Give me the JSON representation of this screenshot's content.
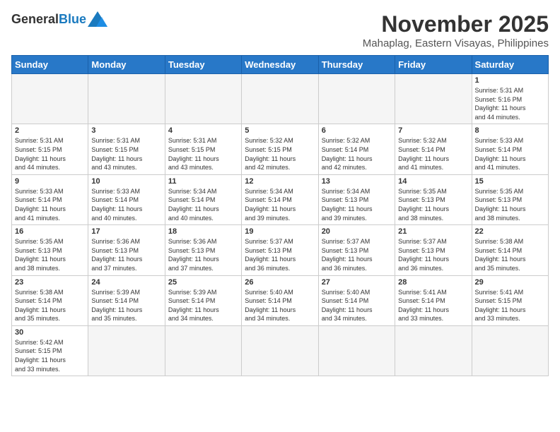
{
  "logo": {
    "general": "General",
    "blue": "Blue"
  },
  "header": {
    "month": "November 2025",
    "location": "Mahaplag, Eastern Visayas, Philippines"
  },
  "weekdays": [
    "Sunday",
    "Monday",
    "Tuesday",
    "Wednesday",
    "Thursday",
    "Friday",
    "Saturday"
  ],
  "weeks": [
    [
      {
        "day": "",
        "info": ""
      },
      {
        "day": "",
        "info": ""
      },
      {
        "day": "",
        "info": ""
      },
      {
        "day": "",
        "info": ""
      },
      {
        "day": "",
        "info": ""
      },
      {
        "day": "",
        "info": ""
      },
      {
        "day": "1",
        "info": "Sunrise: 5:31 AM\nSunset: 5:16 PM\nDaylight: 11 hours\nand 44 minutes."
      }
    ],
    [
      {
        "day": "2",
        "info": "Sunrise: 5:31 AM\nSunset: 5:15 PM\nDaylight: 11 hours\nand 44 minutes."
      },
      {
        "day": "3",
        "info": "Sunrise: 5:31 AM\nSunset: 5:15 PM\nDaylight: 11 hours\nand 43 minutes."
      },
      {
        "day": "4",
        "info": "Sunrise: 5:31 AM\nSunset: 5:15 PM\nDaylight: 11 hours\nand 43 minutes."
      },
      {
        "day": "5",
        "info": "Sunrise: 5:32 AM\nSunset: 5:15 PM\nDaylight: 11 hours\nand 42 minutes."
      },
      {
        "day": "6",
        "info": "Sunrise: 5:32 AM\nSunset: 5:14 PM\nDaylight: 11 hours\nand 42 minutes."
      },
      {
        "day": "7",
        "info": "Sunrise: 5:32 AM\nSunset: 5:14 PM\nDaylight: 11 hours\nand 41 minutes."
      },
      {
        "day": "8",
        "info": "Sunrise: 5:33 AM\nSunset: 5:14 PM\nDaylight: 11 hours\nand 41 minutes."
      }
    ],
    [
      {
        "day": "9",
        "info": "Sunrise: 5:33 AM\nSunset: 5:14 PM\nDaylight: 11 hours\nand 41 minutes."
      },
      {
        "day": "10",
        "info": "Sunrise: 5:33 AM\nSunset: 5:14 PM\nDaylight: 11 hours\nand 40 minutes."
      },
      {
        "day": "11",
        "info": "Sunrise: 5:34 AM\nSunset: 5:14 PM\nDaylight: 11 hours\nand 40 minutes."
      },
      {
        "day": "12",
        "info": "Sunrise: 5:34 AM\nSunset: 5:14 PM\nDaylight: 11 hours\nand 39 minutes."
      },
      {
        "day": "13",
        "info": "Sunrise: 5:34 AM\nSunset: 5:13 PM\nDaylight: 11 hours\nand 39 minutes."
      },
      {
        "day": "14",
        "info": "Sunrise: 5:35 AM\nSunset: 5:13 PM\nDaylight: 11 hours\nand 38 minutes."
      },
      {
        "day": "15",
        "info": "Sunrise: 5:35 AM\nSunset: 5:13 PM\nDaylight: 11 hours\nand 38 minutes."
      }
    ],
    [
      {
        "day": "16",
        "info": "Sunrise: 5:35 AM\nSunset: 5:13 PM\nDaylight: 11 hours\nand 38 minutes."
      },
      {
        "day": "17",
        "info": "Sunrise: 5:36 AM\nSunset: 5:13 PM\nDaylight: 11 hours\nand 37 minutes."
      },
      {
        "day": "18",
        "info": "Sunrise: 5:36 AM\nSunset: 5:13 PM\nDaylight: 11 hours\nand 37 minutes."
      },
      {
        "day": "19",
        "info": "Sunrise: 5:37 AM\nSunset: 5:13 PM\nDaylight: 11 hours\nand 36 minutes."
      },
      {
        "day": "20",
        "info": "Sunrise: 5:37 AM\nSunset: 5:13 PM\nDaylight: 11 hours\nand 36 minutes."
      },
      {
        "day": "21",
        "info": "Sunrise: 5:37 AM\nSunset: 5:13 PM\nDaylight: 11 hours\nand 36 minutes."
      },
      {
        "day": "22",
        "info": "Sunrise: 5:38 AM\nSunset: 5:14 PM\nDaylight: 11 hours\nand 35 minutes."
      }
    ],
    [
      {
        "day": "23",
        "info": "Sunrise: 5:38 AM\nSunset: 5:14 PM\nDaylight: 11 hours\nand 35 minutes."
      },
      {
        "day": "24",
        "info": "Sunrise: 5:39 AM\nSunset: 5:14 PM\nDaylight: 11 hours\nand 35 minutes."
      },
      {
        "day": "25",
        "info": "Sunrise: 5:39 AM\nSunset: 5:14 PM\nDaylight: 11 hours\nand 34 minutes."
      },
      {
        "day": "26",
        "info": "Sunrise: 5:40 AM\nSunset: 5:14 PM\nDaylight: 11 hours\nand 34 minutes."
      },
      {
        "day": "27",
        "info": "Sunrise: 5:40 AM\nSunset: 5:14 PM\nDaylight: 11 hours\nand 34 minutes."
      },
      {
        "day": "28",
        "info": "Sunrise: 5:41 AM\nSunset: 5:14 PM\nDaylight: 11 hours\nand 33 minutes."
      },
      {
        "day": "29",
        "info": "Sunrise: 5:41 AM\nSunset: 5:15 PM\nDaylight: 11 hours\nand 33 minutes."
      }
    ],
    [
      {
        "day": "30",
        "info": "Sunrise: 5:42 AM\nSunset: 5:15 PM\nDaylight: 11 hours\nand 33 minutes."
      },
      {
        "day": "",
        "info": ""
      },
      {
        "day": "",
        "info": ""
      },
      {
        "day": "",
        "info": ""
      },
      {
        "day": "",
        "info": ""
      },
      {
        "day": "",
        "info": ""
      },
      {
        "day": "",
        "info": ""
      }
    ]
  ]
}
